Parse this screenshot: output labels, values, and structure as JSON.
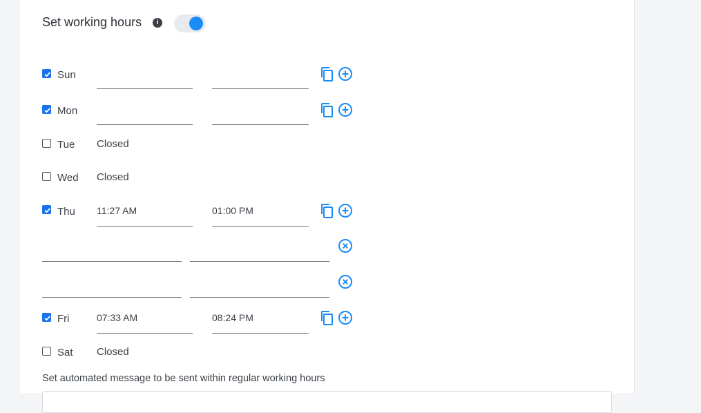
{
  "section": {
    "title": "Set working hours",
    "info_icon": "info-icon",
    "toggle_on": true,
    "accent_color": "#1a8cf5"
  },
  "days": {
    "sun": {
      "label": "Sun",
      "checked": true,
      "start": "",
      "end": ""
    },
    "mon": {
      "label": "Mon",
      "checked": true,
      "start": "",
      "end": ""
    },
    "tue": {
      "label": "Tue",
      "checked": false,
      "status": "Closed"
    },
    "wed": {
      "label": "Wed",
      "checked": false,
      "status": "Closed"
    },
    "thu": {
      "label": "Thu",
      "checked": true,
      "start": "11:27 AM",
      "end": "01:00 PM",
      "extra_ranges": [
        {
          "start": "",
          "end": ""
        },
        {
          "start": "",
          "end": ""
        }
      ]
    },
    "fri": {
      "label": "Fri",
      "checked": true,
      "start": "07:33 AM",
      "end": "08:24 PM"
    },
    "sat": {
      "label": "Sat",
      "checked": false,
      "status": "Closed"
    }
  },
  "icons": {
    "copy": "copy-icon",
    "add": "add-circle-icon",
    "remove": "remove-circle-icon"
  },
  "footer": {
    "automated_message_label": "Set automated message to be sent within regular working hours"
  }
}
